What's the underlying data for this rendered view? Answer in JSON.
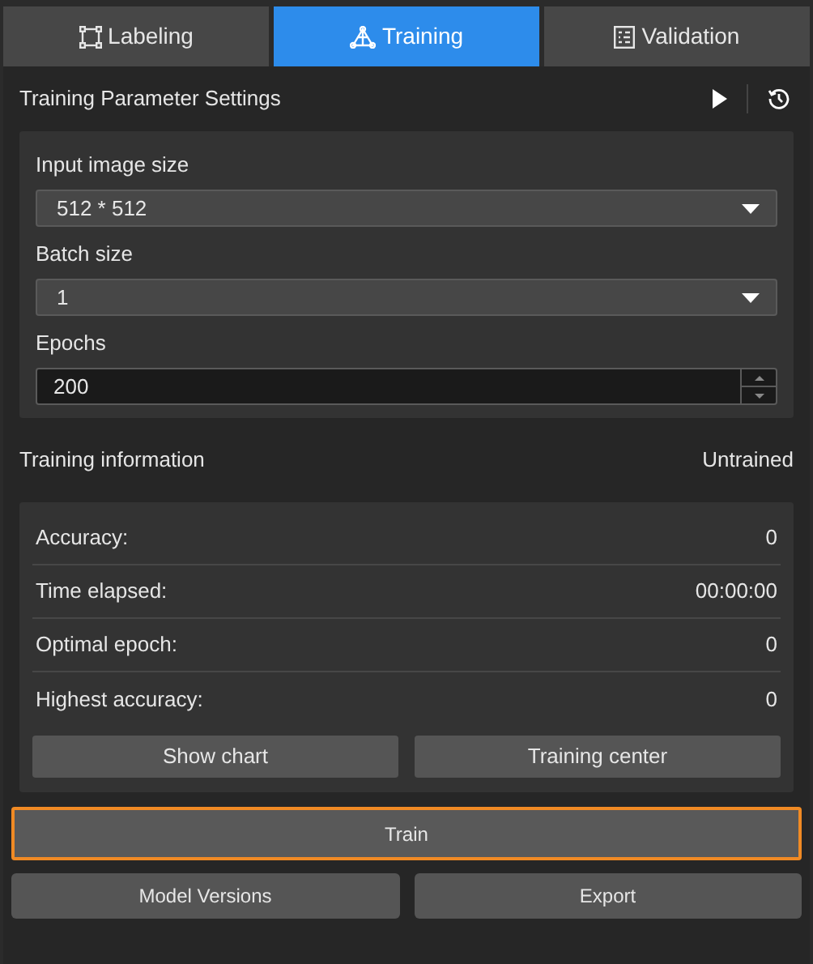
{
  "tabs": [
    {
      "label": "Labeling",
      "selected": false
    },
    {
      "label": "Training",
      "selected": true
    },
    {
      "label": "Validation",
      "selected": false
    }
  ],
  "settings": {
    "title": "Training Parameter Settings",
    "fields": [
      {
        "kind": "dropdown",
        "label": "Input image size",
        "value": "512 * 512"
      },
      {
        "kind": "dropdown",
        "label": "Batch size",
        "value": "1"
      },
      {
        "kind": "spinner",
        "label": "Epochs",
        "value": "200"
      }
    ]
  },
  "info": {
    "title": "Training information",
    "status": "Untrained",
    "rows": [
      {
        "label": "Accuracy:",
        "value": "0"
      },
      {
        "label": "Time elapsed:",
        "value": "00:00:00"
      },
      {
        "label": "Optimal epoch:",
        "value": "0"
      },
      {
        "label": "Highest accuracy:",
        "value": "0"
      }
    ],
    "buttons": [
      "Show chart",
      "Training center"
    ]
  },
  "train_button": {
    "label": "Train",
    "focused": true
  },
  "bottom_buttons": [
    "Model Versions",
    "Export"
  ]
}
